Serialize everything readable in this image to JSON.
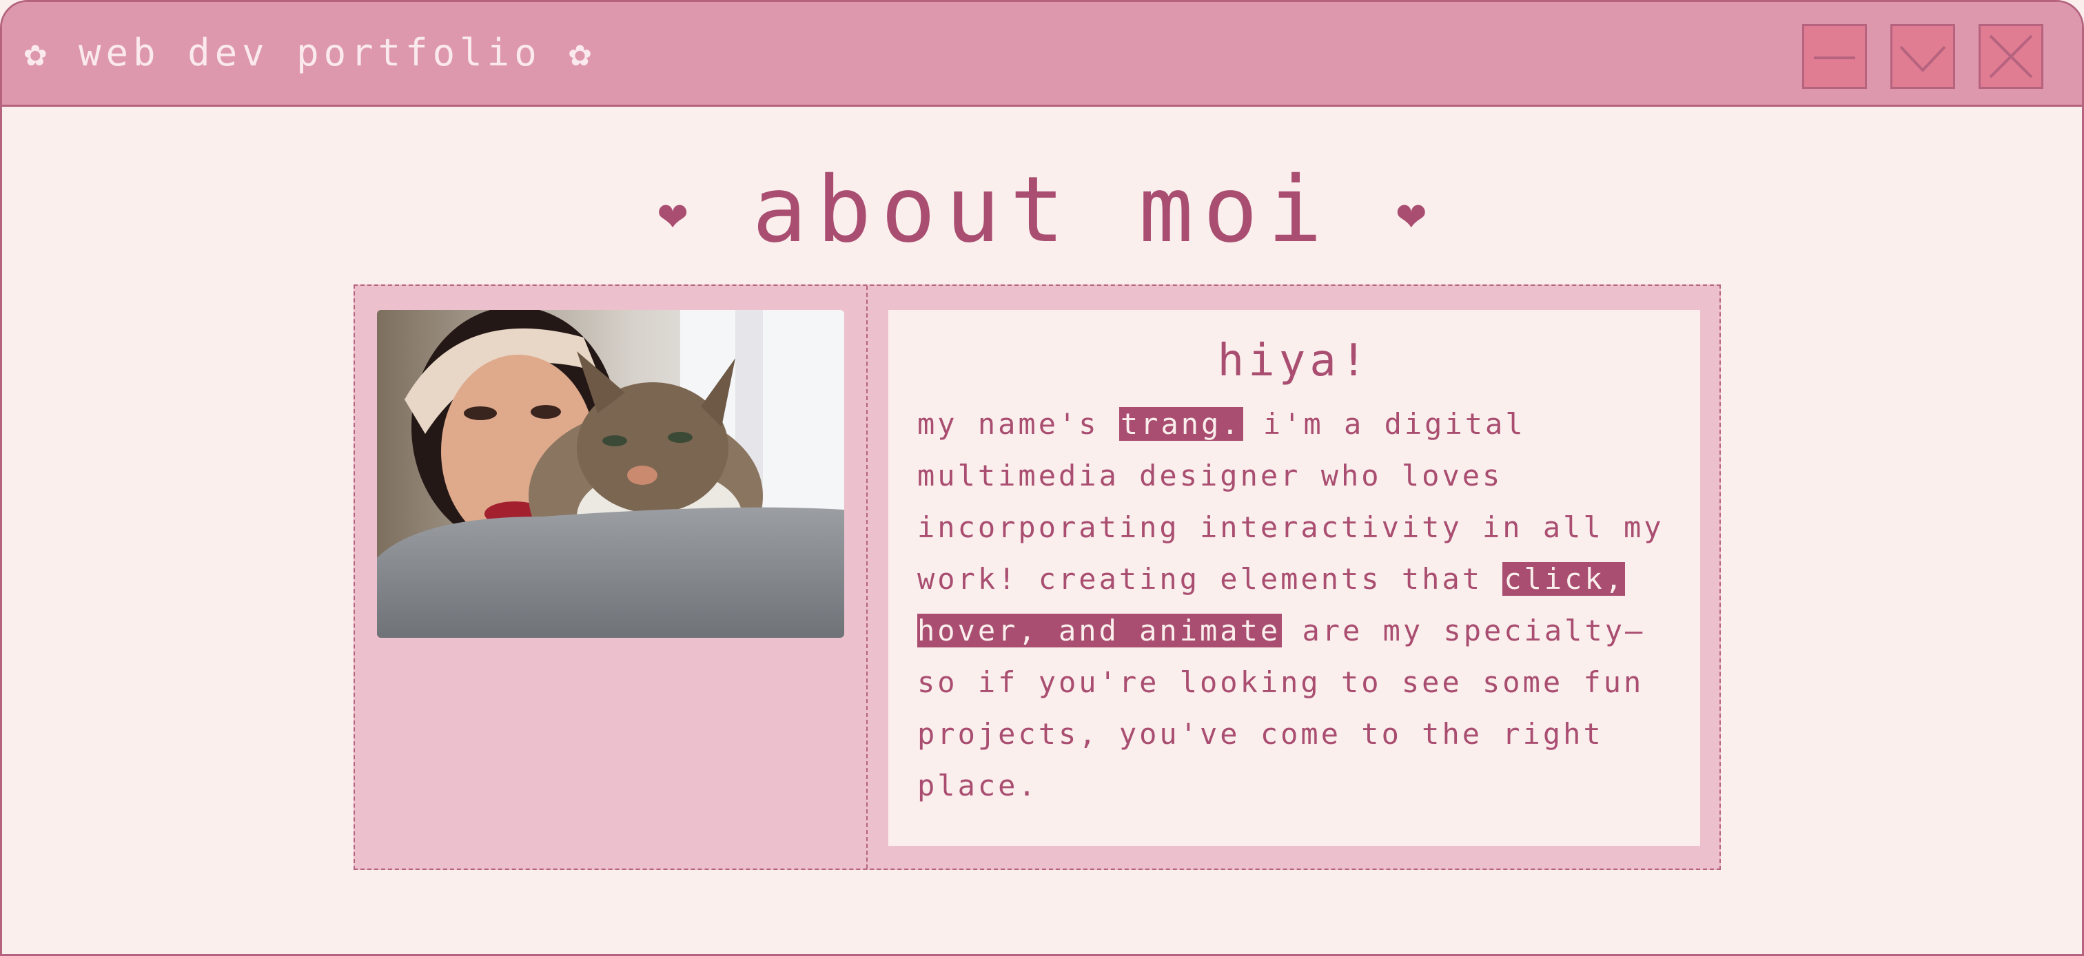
{
  "window": {
    "title": "✿ web dev portfolio ✿",
    "buttons": {
      "minimize": "minimize-icon",
      "maximize": "chevron-down-icon",
      "close": "close-icon"
    }
  },
  "colors": {
    "accent": "#a94e70",
    "titlebar": "#de98ad",
    "panel": "#ecc0cd",
    "background": "#fbefee",
    "button": "#e17d93"
  },
  "about": {
    "heart_left": "❤",
    "heading": "about moi",
    "heart_right": "❤",
    "card_title": "hiya!",
    "body": {
      "p1": "my name's ",
      "name": "trang.",
      "p2": " i'm a digital multimedia designer who loves incorporating interactivity in all my work! creating elements that ",
      "highlight": "click, hover, and animate",
      "p3": " are my specialty—so if you're looking to see some fun projects, you've come to the right place."
    }
  }
}
